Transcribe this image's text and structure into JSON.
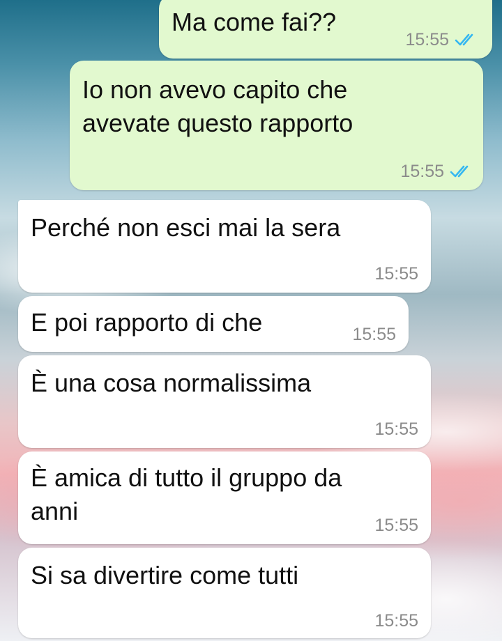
{
  "messages": [
    {
      "direction": "sent",
      "text": "Ma come fai??",
      "time": "15:55",
      "status": "read"
    },
    {
      "direction": "sent",
      "text_lines": [
        "Io non avevo capito che",
        "avevate questo rapporto"
      ],
      "time": "15:55",
      "status": "read"
    },
    {
      "direction": "received",
      "text": "Perché non esci mai la sera",
      "time": "15:55"
    },
    {
      "direction": "received",
      "text": "E poi rapporto di che",
      "time": "15:55"
    },
    {
      "direction": "received",
      "text": "È una cosa normalissima",
      "time": "15:55"
    },
    {
      "direction": "received",
      "text_lines": [
        "È amica di tutto il gruppo da",
        "anni"
      ],
      "time": "15:55"
    },
    {
      "direction": "received",
      "text": "Si sa divertire come tutti",
      "time": "15:55"
    }
  ],
  "icons": {
    "read_receipt": "double-check-icon"
  },
  "colors": {
    "sent_bubble": "#e2f9cf",
    "received_bubble": "#ffffff",
    "read_check": "#34b7f1",
    "timestamp": "#8b8b8b"
  }
}
